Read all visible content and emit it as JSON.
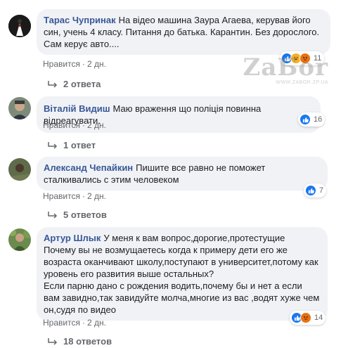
{
  "comments": [
    {
      "author": "Тарас Чупринак",
      "text": "На відео машина Заура Агаева, керував його син, учень 4 класу. Питання до батька. Карантин. Без дорослого. Сам керує авто....",
      "reaction_count": "11",
      "reactions": [
        "like-icon",
        "haha-icon",
        "angry-icon"
      ],
      "like_label": "Нравится",
      "time": "2 дн.",
      "replies": "2 ответа"
    },
    {
      "author": "Віталій Видиш",
      "text": "Маю враження що поліція повинна відреагувати.",
      "reaction_count": "16",
      "reactions": [
        "like-icon"
      ],
      "like_label": "Нравится",
      "time": "2 дн.",
      "replies": "1 ответ"
    },
    {
      "author": "Александ Чепайкин",
      "text": "Пишите все равно не поможет сталкивались с этим человеком",
      "reaction_count": "7",
      "reactions": [
        "like-icon"
      ],
      "like_label": "Нравится",
      "time": "2 дн.",
      "replies": "5 ответов"
    },
    {
      "author": "Артур Шлык",
      "text": "У меня к вам вопрос,дорогие,протестущие\nПочему вы не возмущаетесь когда к примеру дети его же возраста оканчивают школу,поступают в университет,потому как уровень его развития выше остальных?\nЕсли парню дано с рождения водить,почему бы и нет а если вам завидно,так завидуйте молча,многие из вас ,водят хуже чем он,судя по видео",
      "reaction_count": "14",
      "reactions": [
        "like-icon",
        "angry-icon"
      ],
      "like_label": "Нравится",
      "time": "2 дн.",
      "replies": "18 ответов"
    }
  ],
  "separator": "·",
  "watermark": {
    "brand": "ZaБor",
    "url": "WWW.ZABOR.ZP.UA"
  },
  "colors": {
    "author": "#385898",
    "bubble": "#f0f2f5",
    "like": "#1877f2",
    "meta": "#65676b"
  }
}
